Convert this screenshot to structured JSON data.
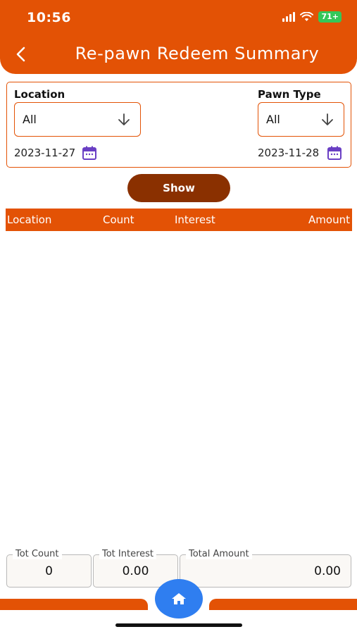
{
  "status_bar": {
    "time": "10:56",
    "battery": "71+"
  },
  "header": {
    "title": "Re-pawn Redeem Summary"
  },
  "filters": {
    "location_label": "Location",
    "location_value": "All",
    "pawn_type_label": "Pawn Type",
    "pawn_type_value": "All",
    "from_date": "2023-11-27",
    "to_date": "2023-11-28"
  },
  "actions": {
    "show_label": "Show"
  },
  "table": {
    "columns": [
      "Location",
      "Count",
      "Interest",
      "Amount"
    ],
    "rows": []
  },
  "totals": {
    "count_label": "Tot Count",
    "count_value": "0",
    "interest_label": "Tot Interest",
    "interest_value": "0.00",
    "amount_label": "Total Amount",
    "amount_value": "0.00"
  },
  "icons": {
    "back": "chevron-left-icon",
    "dropdown": "arrow-down-icon",
    "calendar": "calendar-icon",
    "home": "home-icon"
  },
  "colors": {
    "primary": "#e35205",
    "button_dark": "#8a3000",
    "home_button": "#2f7ef0",
    "calendar_icon": "#6a3fc4"
  }
}
